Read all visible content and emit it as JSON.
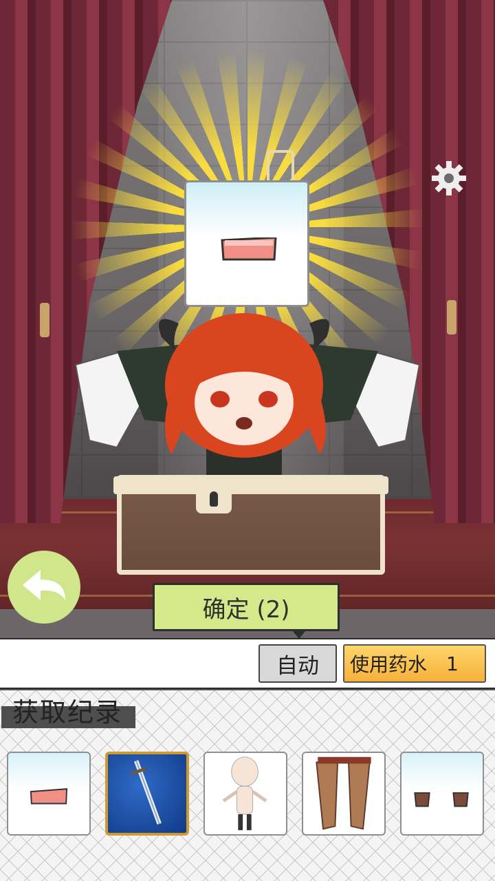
{
  "stage": {
    "reward_item": "red-cloth-piece-icon"
  },
  "controls": {
    "settings_icon": "gear-icon",
    "back_icon": "undo-arrow-icon",
    "confirm_label": "确定 (2)",
    "auto_label": "自动",
    "potion_label": "使用药水",
    "potion_count": "1"
  },
  "records": {
    "title": "获取纪录",
    "items": [
      {
        "icon": "red-cloth-piece-icon"
      },
      {
        "icon": "sword-icon"
      },
      {
        "icon": "body-base-icon"
      },
      {
        "icon": "brown-boots-icon"
      },
      {
        "icon": "wrist-cuffs-icon"
      }
    ]
  },
  "colors": {
    "confirm_bg": "#d6e98a",
    "potion_bg": "#f6b13a",
    "curtain": "#7a2d3d",
    "back_btn": "#cfe68a"
  }
}
